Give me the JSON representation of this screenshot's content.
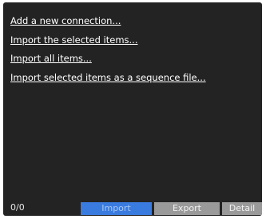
{
  "actions": [
    {
      "label": "Add a new connection..."
    },
    {
      "label": "Import the selected items..."
    },
    {
      "label": "Import all items..."
    },
    {
      "label": "Import selected items as a sequence file..."
    }
  ],
  "footer": {
    "counter": "0/0",
    "tabs": [
      {
        "label": "Import",
        "selected": true
      },
      {
        "label": "Export",
        "selected": false
      },
      {
        "label": "Detail",
        "selected": false
      }
    ]
  },
  "colors": {
    "panel_background": "#232323",
    "selected_tab": "#3a7be0",
    "unselected_tab": "#9a9a9a",
    "link_text": "#ffffff"
  }
}
